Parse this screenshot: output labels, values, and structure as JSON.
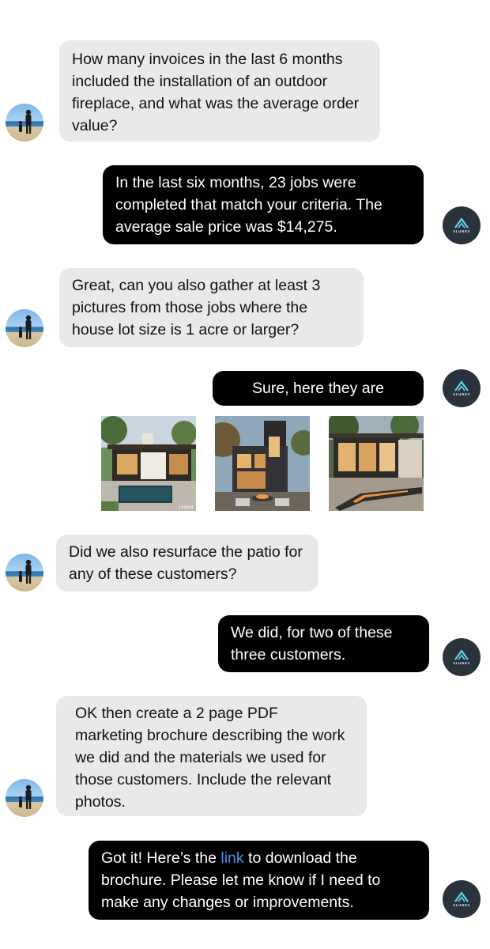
{
  "messages": [
    {
      "role": "user",
      "text": "How many invoices in the last 6 months included the installation of an outdoor fireplace, and what was the average order value?"
    },
    {
      "role": "assistant",
      "text": "In the last six months, 23 jobs were completed that match your criteria. The average sale price was $14,275."
    },
    {
      "role": "user",
      "text": "Great, can you also gather at least 3 pictures from those jobs where the house lot size is 1 acre or larger?"
    },
    {
      "role": "assistant",
      "text": "Sure, here they are"
    },
    {
      "role": "user",
      "text": "Did we also resurface the patio for any of these customers?"
    },
    {
      "role": "assistant",
      "text": "We did, for two of these three customers."
    },
    {
      "role": "user",
      "text": "OK then create a 2 page PDF marketing brochure describing the work we did and the materials we used for those customers. Include the relevant photos."
    },
    {
      "role": "assistant",
      "before_link": "Got it! Here’s the ",
      "link_text": "link",
      "after_link": " to download the brochure. Please let me know if I need to make any changes or improvements."
    }
  ],
  "bot_brand": "ALUNEX",
  "photos": [
    {
      "name": "modern-house-pool-photo",
      "watermark": "Linked"
    },
    {
      "name": "dark-modern-house-firepit-photo"
    },
    {
      "name": "stone-house-fire-trough-photo"
    }
  ],
  "colors": {
    "user_bubble": "#e9e9eb",
    "bot_bubble": "#000000",
    "link": "#4a90f0",
    "bot_avatar": "#2a323b"
  }
}
